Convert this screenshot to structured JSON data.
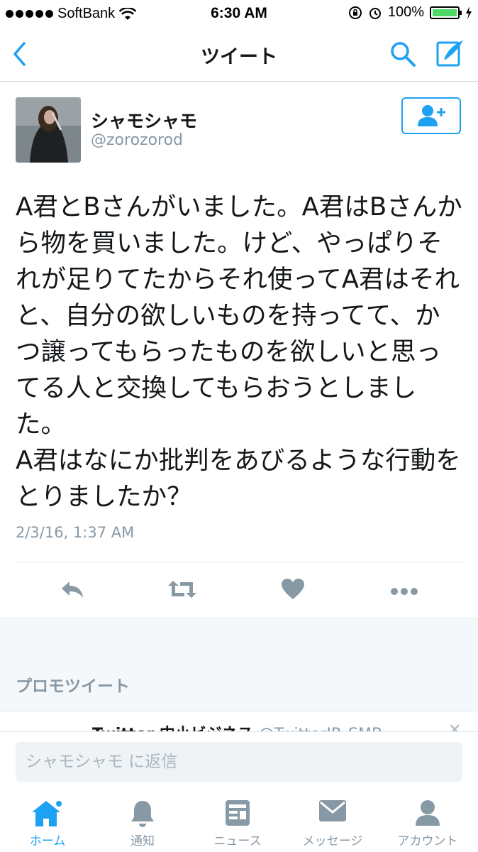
{
  "status_bar": {
    "carrier": "SoftBank",
    "time": "6:30 AM",
    "battery": "100%"
  },
  "nav": {
    "title": "ツイート"
  },
  "tweet": {
    "display_name": "シャモシャモ",
    "handle": "@zorozorod",
    "text": "A君とBさんがいました。A君はBさんから物を買いました。けど、やっぱりそれが足りてたからそれ使ってA君はそれと、自分の欲しいものを持ってて、かつ譲ってもらったものを欲しいと思ってる人と交換してもらおうとしました。\nA君はなにか批判をあびるような行動をとりましたか？",
    "timestamp": "2/3/16, 1:37 AM"
  },
  "promoted": {
    "label": "プロモツイート",
    "peek_name": "Twitter 中小ビジネス",
    "peek_handle": "@TwitterJP_SMB"
  },
  "reply": {
    "placeholder": "シャモシャモ に返信"
  },
  "tabs": [
    {
      "label": "ホーム",
      "icon": "home-icon",
      "active": true
    },
    {
      "label": "通知",
      "icon": "bell-icon"
    },
    {
      "label": "ニュース",
      "icon": "news-icon"
    },
    {
      "label": "メッセージ",
      "icon": "envelope-icon"
    },
    {
      "label": "アカウント",
      "icon": "person-icon"
    }
  ],
  "colors": {
    "accent": "#1da1f2",
    "muted": "#8899a6"
  }
}
